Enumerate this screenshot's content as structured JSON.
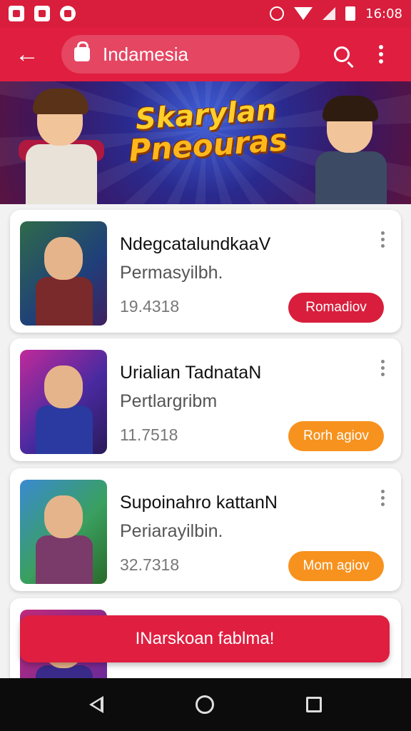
{
  "status_bar": {
    "time": "16:08",
    "left_icons": [
      "gallery-icon",
      "notification-icon",
      "messenger-icon"
    ],
    "right_icons": [
      "alarm-icon",
      "wifi-icon",
      "signal-icon",
      "battery-icon"
    ]
  },
  "app_bar": {
    "back_icon": "back-arrow-icon",
    "search_text": "Indamesia",
    "search_icon": "search-icon",
    "more_icon": "more-vert-icon"
  },
  "banner": {
    "title_line1": "Skarylan",
    "title_line2": "Pneouras"
  },
  "cards": [
    {
      "title": "NdegcatalundkaaV",
      "subtitle": "Permasyilbh.",
      "number": "19.4318",
      "button": "Romadiov",
      "button_color": "#d81e3c"
    },
    {
      "title": "Urialian TadnataN",
      "subtitle": "Pertlargribm",
      "number": "11.7518",
      "button": "Rorh agiov",
      "button_color": "#f7921e"
    },
    {
      "title": "Supoinahro kattanN",
      "subtitle": "Periarayilbin.",
      "number": "32.7318",
      "button": "Mom agiov",
      "button_color": "#f7921e"
    }
  ],
  "cta": {
    "label": "INarskoan fablma!"
  },
  "colors": {
    "primary": "#e01e40",
    "status": "#d81e3c",
    "accent_orange": "#f7921e"
  },
  "nav_bar": {
    "icons": [
      "nav-back-icon",
      "nav-home-icon",
      "nav-recents-icon"
    ]
  }
}
